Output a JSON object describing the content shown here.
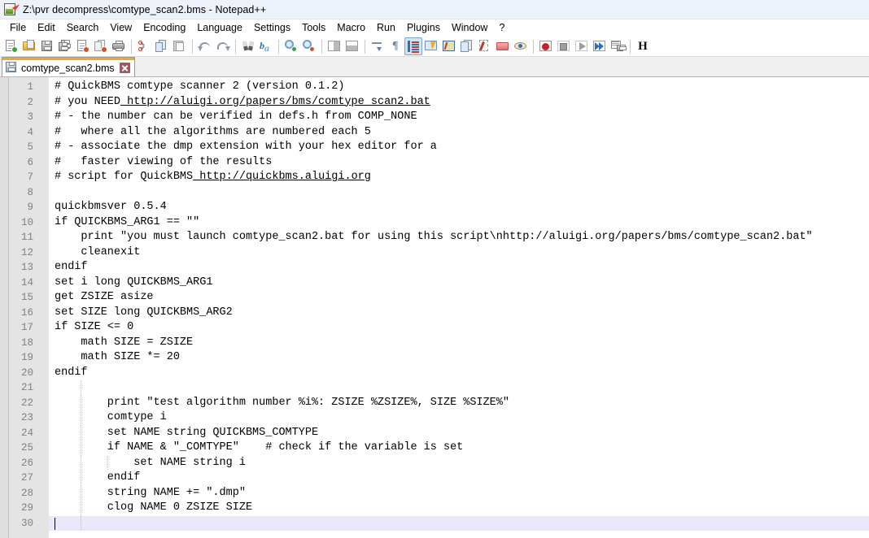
{
  "window": {
    "title": "Z:\\pvr decompress\\comtype_scan2.bms - Notepad++",
    "app_icon": "notepad-plus-plus-icon",
    "titlebar_bg": "#edf1fa"
  },
  "menubar": {
    "items": [
      {
        "label": "File"
      },
      {
        "label": "Edit"
      },
      {
        "label": "Search"
      },
      {
        "label": "View"
      },
      {
        "label": "Encoding"
      },
      {
        "label": "Language"
      },
      {
        "label": "Settings"
      },
      {
        "label": "Tools"
      },
      {
        "label": "Macro"
      },
      {
        "label": "Run"
      },
      {
        "label": "Plugins"
      },
      {
        "label": "Window"
      },
      {
        "label": "?"
      }
    ]
  },
  "toolbar": {
    "buttons": [
      {
        "name": "new-file-icon",
        "title": "New"
      },
      {
        "name": "open-file-icon",
        "title": "Open"
      },
      {
        "name": "save-icon",
        "title": "Save"
      },
      {
        "name": "save-all-icon",
        "title": "Save All"
      },
      {
        "name": "close-file-icon",
        "title": "Close"
      },
      {
        "name": "close-all-icon",
        "title": "Close All"
      },
      {
        "name": "print-icon",
        "title": "Print"
      },
      {
        "name": "separator-1",
        "title": ""
      },
      {
        "name": "cut-icon",
        "title": "Cut"
      },
      {
        "name": "copy-icon",
        "title": "Copy"
      },
      {
        "name": "paste-icon",
        "title": "Paste"
      },
      {
        "name": "separator-2",
        "title": ""
      },
      {
        "name": "undo-icon",
        "title": "Undo"
      },
      {
        "name": "redo-icon",
        "title": "Redo"
      },
      {
        "name": "separator-3",
        "title": ""
      },
      {
        "name": "find-icon",
        "title": "Find"
      },
      {
        "name": "replace-icon",
        "title": "Replace"
      },
      {
        "name": "separator-4",
        "title": ""
      },
      {
        "name": "zoom-in-icon",
        "title": "Zoom In"
      },
      {
        "name": "zoom-out-icon",
        "title": "Zoom Out"
      },
      {
        "name": "separator-5",
        "title": ""
      },
      {
        "name": "sync-vertical-scrolling-icon",
        "title": "Synchronize Vertical Scrolling"
      },
      {
        "name": "sync-horizontal-scrolling-icon",
        "title": "Synchronize Horizontal Scrolling"
      },
      {
        "name": "word-wrap-icon",
        "title": "Word wrap"
      },
      {
        "name": "show-all-characters-icon",
        "title": "Show All Characters"
      },
      {
        "name": "show-indent-guide-icon",
        "title": "Show Indent Guide"
      },
      {
        "name": "user-defined-dialogue-icon",
        "title": "User-Defined Dialogue"
      },
      {
        "name": "document-map-icon",
        "title": "Document Map"
      },
      {
        "name": "function-list-icon",
        "title": "Function List"
      },
      {
        "name": "folder-as-workspace-icon",
        "title": "Folder as Workspace"
      },
      {
        "name": "monitoring-icon",
        "title": "Monitoring"
      },
      {
        "name": "separator-6",
        "title": ""
      },
      {
        "name": "record-macro-icon",
        "title": "Start Recording"
      },
      {
        "name": "stop-recording-icon",
        "title": "Stop Recording"
      },
      {
        "name": "play-macro-icon",
        "title": "Playback"
      },
      {
        "name": "run-macro-multiple-icon",
        "title": "Run a Macro Multiple Times"
      },
      {
        "name": "save-macro-icon",
        "title": "Save Current Recorded Macro"
      },
      {
        "name": "separator-7",
        "title": ""
      },
      {
        "name": "hex-editor-icon",
        "title": "H"
      }
    ],
    "hex_label": "H",
    "active_button": "show-indent-guide-icon"
  },
  "tabs": {
    "items": [
      {
        "label": "comtype_scan2.bms",
        "icon": "saved-document-icon",
        "active": true,
        "close_label": "×",
        "active_indicator_color": "#f5a623"
      }
    ]
  },
  "editor": {
    "current_line": 30,
    "gutter_bg": "#e4e4e4",
    "current_line_bg": "#e8e8f8",
    "lines": [
      {
        "n": 1,
        "text": "# QuickBMS comtype scanner 2 (version 0.1.2)",
        "url_start": -1,
        "url_end": -1,
        "indent_guides": []
      },
      {
        "n": 2,
        "text": "# you NEED http://aluigi.org/papers/bms/comtype_scan2.bat",
        "url_start": 10,
        "url_end": 57,
        "indent_guides": []
      },
      {
        "n": 3,
        "text": "# - the number can be verified in defs.h from COMP_NONE",
        "url_start": -1,
        "url_end": -1,
        "indent_guides": []
      },
      {
        "n": 4,
        "text": "#   where all the algorithms are numbered each 5",
        "url_start": -1,
        "url_end": -1,
        "indent_guides": []
      },
      {
        "n": 5,
        "text": "# - associate the dmp extension with your hex editor for a",
        "url_start": -1,
        "url_end": -1,
        "indent_guides": []
      },
      {
        "n": 6,
        "text": "#   faster viewing of the results",
        "url_start": -1,
        "url_end": -1,
        "indent_guides": []
      },
      {
        "n": 7,
        "text": "# script for QuickBMS http://quickbms.aluigi.org",
        "url_start": 21,
        "url_end": 47,
        "indent_guides": []
      },
      {
        "n": 8,
        "text": "",
        "url_start": -1,
        "url_end": -1,
        "indent_guides": []
      },
      {
        "n": 9,
        "text": "quickbmsver 0.5.4",
        "url_start": -1,
        "url_end": -1,
        "indent_guides": []
      },
      {
        "n": 10,
        "text": "if QUICKBMS_ARG1 == \"\"",
        "url_start": -1,
        "url_end": -1,
        "indent_guides": []
      },
      {
        "n": 11,
        "text": "    print \"you must launch comtype_scan2.bat for using this script\\nhttp://aluigi.org/papers/bms/comtype_scan2.bat\"",
        "url_start": -1,
        "url_end": -1,
        "indent_guides": []
      },
      {
        "n": 12,
        "text": "    cleanexit",
        "url_start": -1,
        "url_end": -1,
        "indent_guides": []
      },
      {
        "n": 13,
        "text": "endif",
        "url_start": -1,
        "url_end": -1,
        "indent_guides": []
      },
      {
        "n": 14,
        "text": "set i long QUICKBMS_ARG1",
        "url_start": -1,
        "url_end": -1,
        "indent_guides": []
      },
      {
        "n": 15,
        "text": "get ZSIZE asize",
        "url_start": -1,
        "url_end": -1,
        "indent_guides": []
      },
      {
        "n": 16,
        "text": "set SIZE long QUICKBMS_ARG2",
        "url_start": -1,
        "url_end": -1,
        "indent_guides": []
      },
      {
        "n": 17,
        "text": "if SIZE <= 0",
        "url_start": -1,
        "url_end": -1,
        "indent_guides": []
      },
      {
        "n": 18,
        "text": "    math SIZE = ZSIZE",
        "url_start": -1,
        "url_end": -1,
        "indent_guides": []
      },
      {
        "n": 19,
        "text": "    math SIZE *= 20",
        "url_start": -1,
        "url_end": -1,
        "indent_guides": []
      },
      {
        "n": 20,
        "text": "endif",
        "url_start": -1,
        "url_end": -1,
        "indent_guides": []
      },
      {
        "n": 21,
        "text": "",
        "url_start": -1,
        "url_end": -1,
        "indent_guides": [
          4
        ]
      },
      {
        "n": 22,
        "text": "        print \"test algorithm number %i%: ZSIZE %ZSIZE%, SIZE %SIZE%\"",
        "url_start": -1,
        "url_end": -1,
        "indent_guides": [
          4
        ]
      },
      {
        "n": 23,
        "text": "        comtype i",
        "url_start": -1,
        "url_end": -1,
        "indent_guides": [
          4
        ]
      },
      {
        "n": 24,
        "text": "        set NAME string QUICKBMS_COMTYPE",
        "url_start": -1,
        "url_end": -1,
        "indent_guides": [
          4
        ]
      },
      {
        "n": 25,
        "text": "        if NAME & \"_COMTYPE\"    # check if the variable is set",
        "url_start": -1,
        "url_end": -1,
        "indent_guides": [
          4
        ]
      },
      {
        "n": 26,
        "text": "            set NAME string i",
        "url_start": -1,
        "url_end": -1,
        "indent_guides": [
          4,
          8
        ]
      },
      {
        "n": 27,
        "text": "        endif",
        "url_start": -1,
        "url_end": -1,
        "indent_guides": [
          4
        ]
      },
      {
        "n": 28,
        "text": "        string NAME += \".dmp\"",
        "url_start": -1,
        "url_end": -1,
        "indent_guides": [
          4
        ]
      },
      {
        "n": 29,
        "text": "        clog NAME 0 ZSIZE SIZE",
        "url_start": -1,
        "url_end": -1,
        "indent_guides": [
          4
        ]
      },
      {
        "n": 30,
        "text": "",
        "url_start": -1,
        "url_end": -1,
        "indent_guides": [
          4
        ]
      }
    ]
  }
}
